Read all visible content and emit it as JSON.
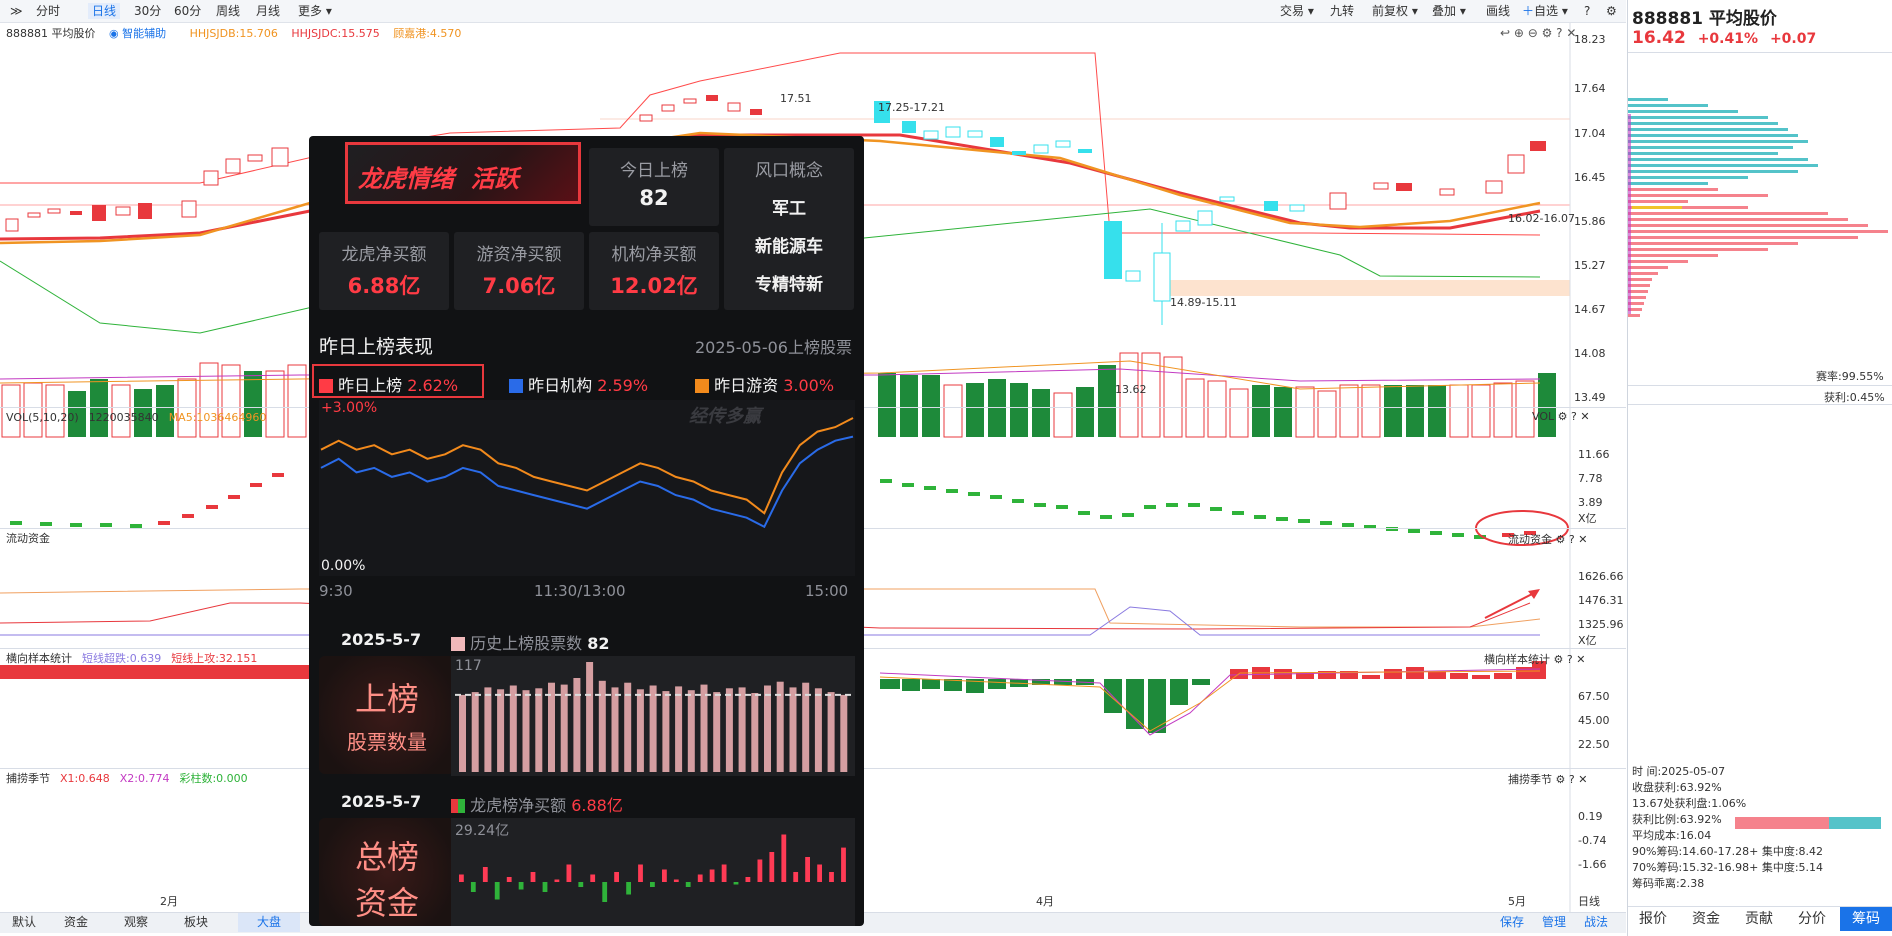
{
  "toolbar": {
    "items": [
      "分时",
      "日线",
      "30分",
      "60分",
      "周线",
      "月线",
      "更多"
    ],
    "right_items": [
      "交易",
      "九转",
      "前复权",
      "叠加",
      "画线",
      "自选"
    ]
  },
  "stock": {
    "header_name": "888881 平均股价",
    "code_name": "888881 平均股价",
    "price": "16.42",
    "pct": "+0.41%",
    "change": "+0.07",
    "smart_assist": "智能辅助",
    "ind_line": [
      "HHJSJDB:15.706",
      "HHJSJDC:15.575",
      "顾嘉港:4.570"
    ]
  },
  "price_axis": [
    "18.23",
    "17.64",
    "17.04",
    "16.45",
    "15.86",
    "15.27",
    "14.67",
    "14.08",
    "13.49"
  ],
  "annotations": {
    "high": "17.51",
    "range1": "17.25-17.21",
    "range2": "16.02-16.07",
    "range3": "14.89-15.11",
    "low": "13.62"
  },
  "vol": {
    "title": "VOL(5,10,20)",
    "value": "1220035840",
    "ma5": "MA5:1036464960",
    "right": "VOL",
    "axis": [
      "11.66",
      "7.78",
      "3.89",
      "X亿"
    ]
  },
  "liquid": {
    "title": "流动资金",
    "right": "流动资金",
    "axis": [
      "1626.66",
      "1476.31",
      "1325.96",
      "X亿"
    ]
  },
  "sample": {
    "title": "横向样本统计",
    "v1": "短线超跌:0.639",
    "v2": "短线上攻:32.151",
    "right": "横向样本统计",
    "axis": [
      "67.50",
      "45.00",
      "22.50"
    ]
  },
  "season": {
    "title": "捕捞季节",
    "x1": "X1:0.648",
    "x2": "X2:0.774",
    "bar": "彩柱数:0.000",
    "right": "捕捞季节",
    "axis": [
      "0.19",
      "-0.74",
      "-1.66"
    ]
  },
  "months": [
    "2月",
    "4月",
    "5月"
  ],
  "bottom_tabs": [
    "默认",
    "资金",
    "观察",
    "板块",
    "大盘"
  ],
  "bottom_right": [
    "保存",
    "管理",
    "战法"
  ],
  "day_line_label": "日线",
  "right_panel": {
    "profit_rate": "赛率:99.55%",
    "gain_rate": "获利:0.45%",
    "info": [
      "时      间:2025-05-07",
      "收盘获利:63.92%",
      "13.67处获利盘:1.06%",
      "获利比例:63.92%",
      "平均成本:16.04",
      "90%筹码:14.60-17.28+ 集中度:8.42",
      "70%筹码:15.32-16.98+ 集中度:5.14",
      "筹码乖离:2.38"
    ],
    "tabs": [
      "报价",
      "资金",
      "贡献",
      "分价",
      "筹码"
    ]
  },
  "popup": {
    "logo": "龙虎情绪  活跃",
    "today_title": "今日上榜",
    "today_value": "82",
    "concept_title": "风口概念",
    "concepts": [
      "军工",
      "新能源车",
      "专精特新"
    ],
    "cards": [
      {
        "title": "龙虎净买额",
        "value": "6.88亿"
      },
      {
        "title": "游资净买额",
        "value": "7.06亿"
      },
      {
        "title": "机构净买额",
        "value": "12.02亿"
      }
    ],
    "perf_title": "昨日上榜表现",
    "perf_date": "2025-05-06上榜股票",
    "legend": [
      {
        "label": "昨日上榜",
        "value": "2.62%",
        "color": "#ff3b45"
      },
      {
        "label": "昨日机构",
        "value": "2.59%",
        "color": "#2a6be8"
      },
      {
        "label": "昨日游资",
        "value": "3.00%",
        "color": "#f28a1c"
      }
    ],
    "chart_top": "+3.00%",
    "chart_bottom": "0.00%",
    "watermark": "经传多赢",
    "time_axis": [
      "9:30",
      "11:30/13:00",
      "15:00"
    ],
    "sec1_date": "2025-5-7",
    "sec1_label": "历史上榜股票数",
    "sec1_value": "82",
    "sec1_big1": "上榜",
    "sec1_big2": "股票数量",
    "sec1_max": "117",
    "sec2_date": "2025-5-7",
    "sec2_label": "龙虎榜净买额",
    "sec2_value": "6.88亿",
    "sec2_big1": "总榜",
    "sec2_big2": "资金",
    "sec2_max": "29.24亿"
  },
  "chart_data": [
    {
      "type": "line",
      "title": "昨日上榜表现",
      "x": [
        "9:30",
        "11:30/13:00",
        "15:00"
      ],
      "ylim": [
        0,
        3.0
      ],
      "series": [
        {
          "name": "昨日机构",
          "values": [
            1.9,
            2.1,
            1.8,
            1.9,
            1.7,
            1.8,
            1.6,
            1.7,
            1.9,
            1.8,
            1.5,
            1.4,
            1.3,
            1.2,
            1.1,
            1.0,
            1.2,
            1.4,
            1.6,
            1.5,
            1.3,
            1.2,
            1.0,
            0.9,
            0.8,
            0.6,
            1.4,
            2.0,
            2.3,
            2.5,
            2.59
          ]
        },
        {
          "name": "昨日游资",
          "values": [
            2.3,
            2.5,
            2.3,
            2.4,
            2.2,
            2.3,
            2.1,
            2.2,
            2.4,
            2.3,
            2.0,
            1.9,
            1.7,
            1.6,
            1.5,
            1.4,
            1.6,
            1.8,
            2.0,
            1.9,
            1.7,
            1.6,
            1.4,
            1.3,
            1.2,
            0.9,
            1.8,
            2.4,
            2.7,
            2.8,
            3.0
          ]
        }
      ]
    },
    {
      "type": "bar",
      "title": "历史上榜股票数",
      "values": [
        82,
        85,
        90,
        88,
        92,
        87,
        89,
        95,
        93,
        100,
        117,
        97,
        90,
        95,
        88,
        92,
        86,
        91,
        87,
        93,
        85,
        89,
        90,
        84,
        92,
        96,
        90,
        95,
        89,
        85,
        82
      ],
      "ylim": [
        0,
        117
      ]
    },
    {
      "type": "bar",
      "title": "龙虎榜净买额",
      "values": [
        1.5,
        -2.0,
        3.0,
        -3.5,
        1.0,
        -1.5,
        2.0,
        -2.0,
        0.5,
        3.5,
        -1.0,
        1.5,
        -4.0,
        2.0,
        -2.5,
        3.5,
        -1.0,
        2.5,
        0.5,
        -1.0,
        1.5,
        2.5,
        3.5,
        -0.5,
        1.0,
        4.5,
        6.0,
        9.5,
        2.0,
        5.0,
        3.5,
        2.0,
        6.88
      ],
      "ylim": [
        -6,
        29.24
      ]
    }
  ]
}
